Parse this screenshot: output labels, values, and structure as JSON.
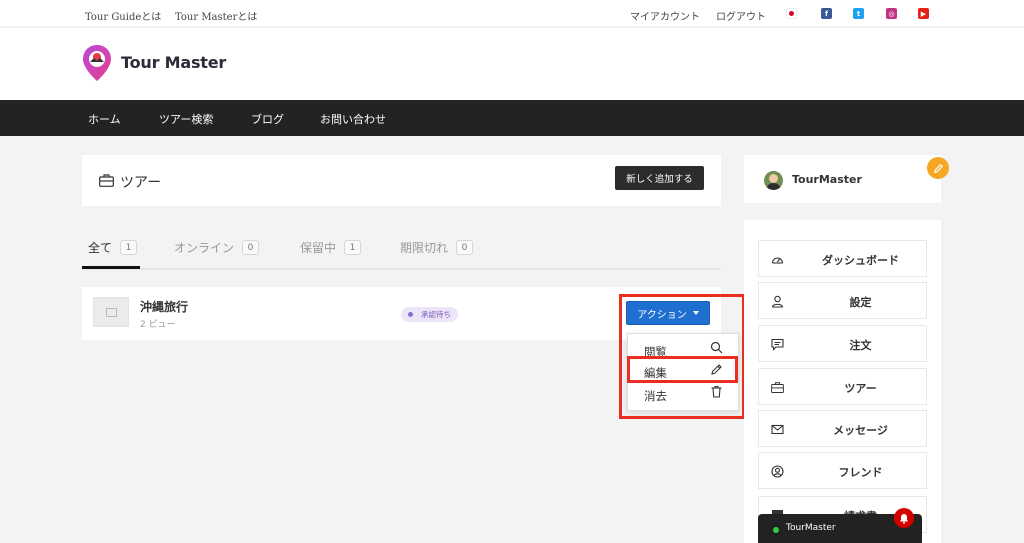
{
  "topbar": {
    "links": [
      "Tour Guideとは",
      "Tour Masterとは"
    ],
    "account": "マイアカウント",
    "logout": "ログアウト",
    "social_icons": [
      "japan-flag-icon",
      "facebook-icon",
      "twitter-icon",
      "instagram-icon",
      "youtube-icon"
    ]
  },
  "header": {
    "logo_text": "Tour Master"
  },
  "nav": {
    "items": [
      "ホーム",
      "ツアー検索",
      "ブログ",
      "お問い合わせ"
    ]
  },
  "tours": {
    "title": "ツアー",
    "add_button": "新しく追加する",
    "tabs": [
      {
        "label": "全て",
        "count": "1"
      },
      {
        "label": "オンライン",
        "count": "0"
      },
      {
        "label": "保留中",
        "count": "1"
      },
      {
        "label": "期限切れ",
        "count": "0"
      }
    ],
    "rows": [
      {
        "name": "沖縄旅行",
        "views": "2 ビュー",
        "status": "承認待ち"
      }
    ],
    "action_button": "アクション",
    "dropdown": [
      "閲覧",
      "編集",
      "消去"
    ]
  },
  "profile": {
    "name": "TourMaster"
  },
  "sidebar_menu": [
    "ダッシュボード",
    "設定",
    "注文",
    "ツアー",
    "メッセージ",
    "フレンド",
    "請求書"
  ],
  "chat": {
    "name": "TourMaster"
  },
  "colors": {
    "nav_bg": "#232323",
    "action_blue": "#1f6fd0",
    "highlight_red": "#ea2e1f",
    "edit_badge": "#f5a623",
    "status_purple": "#7b5cb9",
    "online_green": "#2ecc40",
    "notification_red": "#d40000"
  }
}
